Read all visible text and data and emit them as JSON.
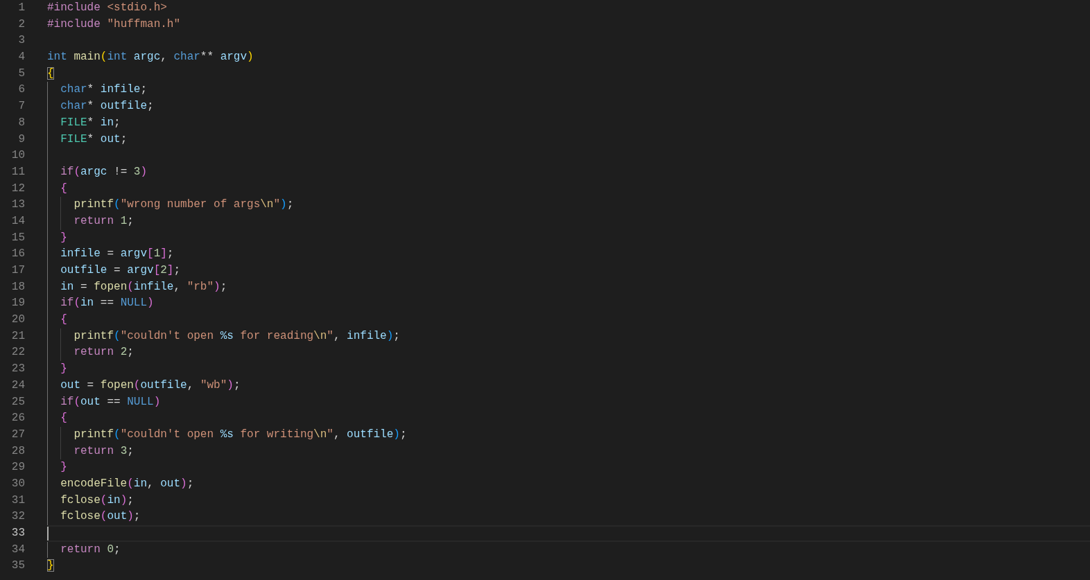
{
  "editor": {
    "lines": [
      {
        "number": "1",
        "current": false,
        "tokens": [
          {
            "kind": "directive",
            "text": "#include "
          },
          {
            "kind": "string",
            "text": "<stdio.h>"
          }
        ]
      },
      {
        "number": "2",
        "current": false,
        "tokens": [
          {
            "kind": "directive",
            "text": "#include "
          },
          {
            "kind": "string",
            "text": "\"huffman.h\""
          }
        ]
      },
      {
        "number": "3",
        "current": false
      },
      {
        "number": "4",
        "current": false,
        "tokens": [
          {
            "kind": "keyword",
            "text": "int "
          },
          {
            "kind": "function",
            "text": "main"
          },
          {
            "kind": "bracket1",
            "text": "("
          },
          {
            "kind": "keyword",
            "text": "int "
          },
          {
            "kind": "variable",
            "text": "argc"
          },
          {
            "kind": "plain",
            "text": ", "
          },
          {
            "kind": "keyword",
            "text": "char"
          },
          {
            "kind": "plain",
            "text": "** "
          },
          {
            "kind": "variable",
            "text": "argv"
          },
          {
            "kind": "bracket1",
            "text": ")"
          }
        ]
      },
      {
        "number": "5",
        "current": false,
        "tokens": [
          {
            "kind": "bracket1",
            "text": "{",
            "matched": true
          }
        ]
      },
      {
        "number": "6",
        "current": false,
        "guides": [
          {
            "active": true
          }
        ],
        "tokens": [
          {
            "kind": "keyword",
            "text": "char"
          },
          {
            "kind": "plain",
            "text": "* "
          },
          {
            "kind": "variable",
            "text": "infile"
          },
          {
            "kind": "plain",
            "text": ";"
          }
        ]
      },
      {
        "number": "7",
        "current": false,
        "guides": [
          {
            "active": true
          }
        ],
        "tokens": [
          {
            "kind": "keyword",
            "text": "char"
          },
          {
            "kind": "plain",
            "text": "* "
          },
          {
            "kind": "variable",
            "text": "outfile"
          },
          {
            "kind": "plain",
            "text": ";"
          }
        ]
      },
      {
        "number": "8",
        "current": false,
        "guides": [
          {
            "active": true
          }
        ],
        "tokens": [
          {
            "kind": "type",
            "text": "FILE"
          },
          {
            "kind": "plain",
            "text": "* "
          },
          {
            "kind": "variable",
            "text": "in"
          },
          {
            "kind": "plain",
            "text": ";"
          }
        ]
      },
      {
        "number": "9",
        "current": false,
        "guides": [
          {
            "active": true
          }
        ],
        "tokens": [
          {
            "kind": "type",
            "text": "FILE"
          },
          {
            "kind": "plain",
            "text": "* "
          },
          {
            "kind": "variable",
            "text": "out"
          },
          {
            "kind": "plain",
            "text": ";"
          }
        ]
      },
      {
        "number": "10",
        "current": false,
        "guides": [
          {
            "active": true
          }
        ]
      },
      {
        "number": "11",
        "current": false,
        "guides": [
          {
            "active": true
          }
        ],
        "tokens": [
          {
            "kind": "control",
            "text": "if"
          },
          {
            "kind": "bracket2",
            "text": "("
          },
          {
            "kind": "variable",
            "text": "argc"
          },
          {
            "kind": "plain",
            "text": " != "
          },
          {
            "kind": "number",
            "text": "3"
          },
          {
            "kind": "bracket2",
            "text": ")"
          }
        ]
      },
      {
        "number": "12",
        "current": false,
        "guides": [
          {
            "active": true
          }
        ],
        "tokens": [
          {
            "kind": "bracket2",
            "text": "{"
          }
        ]
      },
      {
        "number": "13",
        "current": false,
        "guides": [
          {
            "active": true
          },
          {
            "active": false
          }
        ],
        "tokens": [
          {
            "kind": "function",
            "text": "printf"
          },
          {
            "kind": "bracket3",
            "text": "("
          },
          {
            "kind": "string",
            "text": "\"wrong number of args"
          },
          {
            "kind": "escape",
            "text": "\\n"
          },
          {
            "kind": "string",
            "text": "\""
          },
          {
            "kind": "bracket3",
            "text": ")"
          },
          {
            "kind": "plain",
            "text": ";"
          }
        ]
      },
      {
        "number": "14",
        "current": false,
        "guides": [
          {
            "active": true
          },
          {
            "active": false
          }
        ],
        "tokens": [
          {
            "kind": "control",
            "text": "return "
          },
          {
            "kind": "number",
            "text": "1"
          },
          {
            "kind": "plain",
            "text": ";"
          }
        ]
      },
      {
        "number": "15",
        "current": false,
        "guides": [
          {
            "active": true
          }
        ],
        "tokens": [
          {
            "kind": "bracket2",
            "text": "}"
          }
        ]
      },
      {
        "number": "16",
        "current": false,
        "guides": [
          {
            "active": true
          }
        ],
        "tokens": [
          {
            "kind": "variable",
            "text": "infile"
          },
          {
            "kind": "plain",
            "text": " = "
          },
          {
            "kind": "variable",
            "text": "argv"
          },
          {
            "kind": "bracket2",
            "text": "["
          },
          {
            "kind": "number",
            "text": "1"
          },
          {
            "kind": "bracket2",
            "text": "]"
          },
          {
            "kind": "plain",
            "text": ";"
          }
        ]
      },
      {
        "number": "17",
        "current": false,
        "guides": [
          {
            "active": true
          }
        ],
        "tokens": [
          {
            "kind": "variable",
            "text": "outfile"
          },
          {
            "kind": "plain",
            "text": " = "
          },
          {
            "kind": "variable",
            "text": "argv"
          },
          {
            "kind": "bracket2",
            "text": "["
          },
          {
            "kind": "number",
            "text": "2"
          },
          {
            "kind": "bracket2",
            "text": "]"
          },
          {
            "kind": "plain",
            "text": ";"
          }
        ]
      },
      {
        "number": "18",
        "current": false,
        "guides": [
          {
            "active": true
          }
        ],
        "tokens": [
          {
            "kind": "variable",
            "text": "in"
          },
          {
            "kind": "plain",
            "text": " = "
          },
          {
            "kind": "function",
            "text": "fopen"
          },
          {
            "kind": "bracket2",
            "text": "("
          },
          {
            "kind": "variable",
            "text": "infile"
          },
          {
            "kind": "plain",
            "text": ", "
          },
          {
            "kind": "string",
            "text": "\"rb\""
          },
          {
            "kind": "bracket2",
            "text": ")"
          },
          {
            "kind": "plain",
            "text": ";"
          }
        ]
      },
      {
        "number": "19",
        "current": false,
        "guides": [
          {
            "active": true
          }
        ],
        "tokens": [
          {
            "kind": "control",
            "text": "if"
          },
          {
            "kind": "bracket2",
            "text": "("
          },
          {
            "kind": "variable",
            "text": "in"
          },
          {
            "kind": "plain",
            "text": " == "
          },
          {
            "kind": "keyword",
            "text": "NULL"
          },
          {
            "kind": "bracket2",
            "text": ")"
          }
        ]
      },
      {
        "number": "20",
        "current": false,
        "guides": [
          {
            "active": true
          }
        ],
        "tokens": [
          {
            "kind": "bracket2",
            "text": "{"
          }
        ]
      },
      {
        "number": "21",
        "current": false,
        "guides": [
          {
            "active": true
          },
          {
            "active": false
          }
        ],
        "tokens": [
          {
            "kind": "function",
            "text": "printf"
          },
          {
            "kind": "bracket3",
            "text": "("
          },
          {
            "kind": "string",
            "text": "\"couldn't open "
          },
          {
            "kind": "format",
            "text": "%s"
          },
          {
            "kind": "string",
            "text": " for reading"
          },
          {
            "kind": "escape",
            "text": "\\n"
          },
          {
            "kind": "string",
            "text": "\""
          },
          {
            "kind": "plain",
            "text": ", "
          },
          {
            "kind": "variable",
            "text": "infile"
          },
          {
            "kind": "bracket3",
            "text": ")"
          },
          {
            "kind": "plain",
            "text": ";"
          }
        ]
      },
      {
        "number": "22",
        "current": false,
        "guides": [
          {
            "active": true
          },
          {
            "active": false
          }
        ],
        "tokens": [
          {
            "kind": "control",
            "text": "return "
          },
          {
            "kind": "number",
            "text": "2"
          },
          {
            "kind": "plain",
            "text": ";"
          }
        ]
      },
      {
        "number": "23",
        "current": false,
        "guides": [
          {
            "active": true
          }
        ],
        "tokens": [
          {
            "kind": "bracket2",
            "text": "}"
          }
        ]
      },
      {
        "number": "24",
        "current": false,
        "guides": [
          {
            "active": true
          }
        ],
        "tokens": [
          {
            "kind": "variable",
            "text": "out"
          },
          {
            "kind": "plain",
            "text": " = "
          },
          {
            "kind": "function",
            "text": "fopen"
          },
          {
            "kind": "bracket2",
            "text": "("
          },
          {
            "kind": "variable",
            "text": "outfile"
          },
          {
            "kind": "plain",
            "text": ", "
          },
          {
            "kind": "string",
            "text": "\"wb\""
          },
          {
            "kind": "bracket2",
            "text": ")"
          },
          {
            "kind": "plain",
            "text": ";"
          }
        ]
      },
      {
        "number": "25",
        "current": false,
        "guides": [
          {
            "active": true
          }
        ],
        "tokens": [
          {
            "kind": "control",
            "text": "if"
          },
          {
            "kind": "bracket2",
            "text": "("
          },
          {
            "kind": "variable",
            "text": "out"
          },
          {
            "kind": "plain",
            "text": " == "
          },
          {
            "kind": "keyword",
            "text": "NULL"
          },
          {
            "kind": "bracket2",
            "text": ")"
          }
        ]
      },
      {
        "number": "26",
        "current": false,
        "guides": [
          {
            "active": true
          }
        ],
        "tokens": [
          {
            "kind": "bracket2",
            "text": "{"
          }
        ]
      },
      {
        "number": "27",
        "current": false,
        "guides": [
          {
            "active": true
          },
          {
            "active": false
          }
        ],
        "tokens": [
          {
            "kind": "function",
            "text": "printf"
          },
          {
            "kind": "bracket3",
            "text": "("
          },
          {
            "kind": "string",
            "text": "\"couldn't open "
          },
          {
            "kind": "format",
            "text": "%s"
          },
          {
            "kind": "string",
            "text": " for writing"
          },
          {
            "kind": "escape",
            "text": "\\n"
          },
          {
            "kind": "string",
            "text": "\""
          },
          {
            "kind": "plain",
            "text": ", "
          },
          {
            "kind": "variable",
            "text": "outfile"
          },
          {
            "kind": "bracket3",
            "text": ")"
          },
          {
            "kind": "plain",
            "text": ";"
          }
        ]
      },
      {
        "number": "28",
        "current": false,
        "guides": [
          {
            "active": true
          },
          {
            "active": false
          }
        ],
        "tokens": [
          {
            "kind": "control",
            "text": "return "
          },
          {
            "kind": "number",
            "text": "3"
          },
          {
            "kind": "plain",
            "text": ";"
          }
        ]
      },
      {
        "number": "29",
        "current": false,
        "guides": [
          {
            "active": true
          }
        ],
        "tokens": [
          {
            "kind": "bracket2",
            "text": "}"
          }
        ]
      },
      {
        "number": "30",
        "current": false,
        "guides": [
          {
            "active": true
          }
        ],
        "tokens": [
          {
            "kind": "function",
            "text": "encodeFile"
          },
          {
            "kind": "bracket2",
            "text": "("
          },
          {
            "kind": "variable",
            "text": "in"
          },
          {
            "kind": "plain",
            "text": ", "
          },
          {
            "kind": "variable",
            "text": "out"
          },
          {
            "kind": "bracket2",
            "text": ")"
          },
          {
            "kind": "plain",
            "text": ";"
          }
        ]
      },
      {
        "number": "31",
        "current": false,
        "guides": [
          {
            "active": true
          }
        ],
        "tokens": [
          {
            "kind": "function",
            "text": "fclose"
          },
          {
            "kind": "bracket2",
            "text": "("
          },
          {
            "kind": "variable",
            "text": "in"
          },
          {
            "kind": "bracket2",
            "text": ")"
          },
          {
            "kind": "plain",
            "text": ";"
          }
        ]
      },
      {
        "number": "32",
        "current": false,
        "guides": [
          {
            "active": true
          }
        ],
        "tokens": [
          {
            "kind": "function",
            "text": "fclose"
          },
          {
            "kind": "bracket2",
            "text": "("
          },
          {
            "kind": "variable",
            "text": "out"
          },
          {
            "kind": "bracket2",
            "text": ")"
          },
          {
            "kind": "plain",
            "text": ";"
          }
        ]
      },
      {
        "number": "33",
        "current": true
      },
      {
        "number": "34",
        "current": false,
        "guides": [
          {
            "active": true
          }
        ],
        "tokens": [
          {
            "kind": "control",
            "text": "return "
          },
          {
            "kind": "number",
            "text": "0"
          },
          {
            "kind": "plain",
            "text": ";"
          }
        ]
      },
      {
        "number": "35",
        "current": false,
        "tokens": [
          {
            "kind": "bracket1",
            "text": "}",
            "matched": true
          }
        ]
      }
    ]
  }
}
